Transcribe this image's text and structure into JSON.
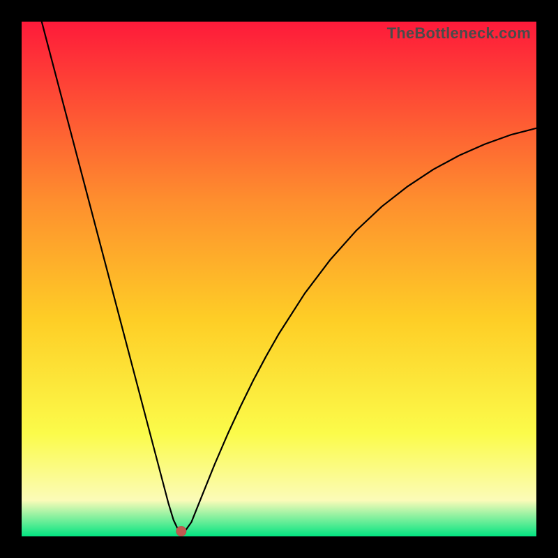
{
  "watermark": "TheBottleneck.com",
  "colors": {
    "gradient_top": "#fe1a3a",
    "gradient_mid_upper": "#fe8f2e",
    "gradient_mid": "#fece26",
    "gradient_mid_lower": "#fbfb4a",
    "gradient_lower": "#fbfbb8",
    "gradient_bottom": "#02e481",
    "curve": "#000000",
    "marker_fill": "#c05a50",
    "marker_stroke": "#b85048",
    "frame": "#000000"
  },
  "chart_data": {
    "type": "line",
    "title": "",
    "xlabel": "",
    "ylabel": "",
    "xlim": [
      0,
      100
    ],
    "ylim": [
      0,
      100
    ],
    "series": [
      {
        "name": "bottleneck-curve",
        "x": [
          3.9,
          5,
          7.5,
          10,
          12.5,
          15,
          17.5,
          20,
          22.5,
          25,
          27.5,
          28.5,
          29.5,
          30.3,
          30.8,
          31.2,
          31.8,
          33,
          35,
          37.5,
          40,
          42.5,
          45,
          47.5,
          50,
          55,
          60,
          65,
          70,
          75,
          80,
          85,
          90,
          95,
          100
        ],
        "values": [
          100,
          95.8,
          86.3,
          76.8,
          67.3,
          57.8,
          48.3,
          38.8,
          29.3,
          19.8,
          10.3,
          6.5,
          3.2,
          1.5,
          1.0,
          1.0,
          1.1,
          2.8,
          7.8,
          14.0,
          19.8,
          25.2,
          30.3,
          35.0,
          39.4,
          47.2,
          53.8,
          59.4,
          64.1,
          68.0,
          71.3,
          74.0,
          76.2,
          78.0,
          79.3
        ]
      }
    ],
    "marker": {
      "x": 31.0,
      "y": 1.0
    }
  }
}
